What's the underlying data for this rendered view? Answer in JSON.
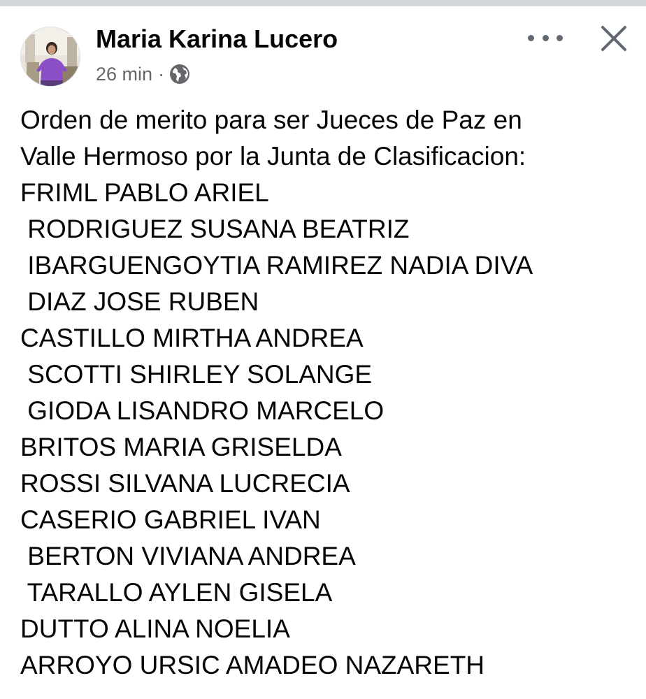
{
  "post": {
    "author": "Maria Karina Lucero",
    "time": "26 min",
    "separator": "·",
    "privacy_icon": "globe-icon",
    "lines": [
      "Orden de merito para ser Jueces de Paz en",
      "Valle Hermoso por la Junta de Clasificacion:",
      "FRIML PABLO ARIEL",
      " RODRIGUEZ SUSANA BEATRIZ",
      " IBARGUENGOYTIA RAMIREZ NADIA DIVA",
      " DIAZ JOSE RUBEN",
      "CASTILLO MIRTHA ANDREA",
      " SCOTTI SHIRLEY SOLANGE",
      " GIODA LISANDRO MARCELO",
      "BRITOS MARIA GRISELDA",
      "ROSSI SILVANA LUCRECIA",
      "CASERIO GABRIEL IVAN",
      " BERTON VIVIANA ANDREA",
      " TARALLO AYLEN GISELA",
      "DUTTO ALINA NOELIA",
      "ARROYO URSIC AMADEO NAZARETH"
    ]
  },
  "icons": {
    "more": "more-options-icon",
    "close": "close-icon"
  },
  "colors": {
    "text": "#050505",
    "meta": "#65676b",
    "top_bar": "#d3d6db",
    "icon": "#606770"
  }
}
